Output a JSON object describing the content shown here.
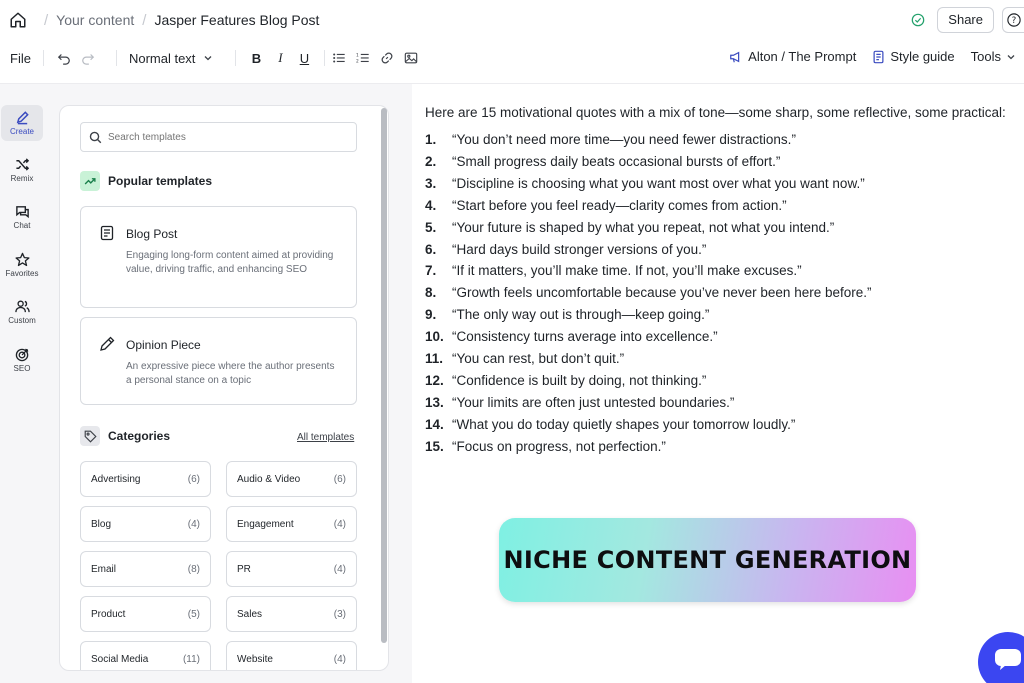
{
  "breadcrumb": {
    "parent": "Your content",
    "current": "Jasper Features Blog Post"
  },
  "header": {
    "share_label": "Share"
  },
  "toolbar": {
    "file_label": "File",
    "text_style": "Normal text",
    "workspace": "Alton / The Prompt",
    "style_guide": "Style guide",
    "tools": "Tools"
  },
  "rail": [
    {
      "label": "Create",
      "icon": "pen-icon",
      "active": true
    },
    {
      "label": "Remix",
      "icon": "shuffle-icon"
    },
    {
      "label": "Chat",
      "icon": "chat-icon"
    },
    {
      "label": "Favorites",
      "icon": "star-icon"
    },
    {
      "label": "Custom",
      "icon": "users-icon"
    },
    {
      "label": "SEO",
      "icon": "target-icon"
    }
  ],
  "sidebar": {
    "search_placeholder": "Search templates",
    "popular_heading": "Popular templates",
    "templates": [
      {
        "title": "Blog Post",
        "desc": "Engaging long-form content aimed at providing value, driving traffic, and enhancing SEO"
      },
      {
        "title": "Opinion Piece",
        "desc": "An expressive piece where the author presents a personal stance on a topic"
      }
    ],
    "categories_heading": "Categories",
    "all_templates": "All templates",
    "categories": [
      {
        "name": "Advertising",
        "count": "(6)"
      },
      {
        "name": "Audio & Video",
        "count": "(6)"
      },
      {
        "name": "Blog",
        "count": "(4)"
      },
      {
        "name": "Engagement",
        "count": "(4)"
      },
      {
        "name": "Email",
        "count": "(8)"
      },
      {
        "name": "PR",
        "count": "(4)"
      },
      {
        "name": "Product",
        "count": "(5)"
      },
      {
        "name": "Sales",
        "count": "(3)"
      },
      {
        "name": "Social Media",
        "count": "(11)"
      },
      {
        "name": "Website",
        "count": "(4)"
      }
    ]
  },
  "document": {
    "intro": "Here are 15 motivational quotes with a mix of tone—some sharp, some reflective, some practical:",
    "quotes": [
      "“You don’t need more time—you need fewer distractions.”",
      "“Small progress daily beats occasional bursts of effort.”",
      "“Discipline is choosing what you want most over what you want now.”",
      "“Start before you feel ready—clarity comes from action.”",
      "“Your future is shaped by what you repeat, not what you intend.”",
      "“Hard days build stronger versions of you.”",
      "“If it matters, you’ll make time. If not, you’ll make excuses.”",
      "“Growth feels uncomfortable because you’ve never been here before.”",
      "“The only way out is through—keep going.”",
      "“Consistency turns average into excellence.”",
      "“You can rest, but don’t quit.”",
      "“Confidence is built by doing, not thinking.”",
      "“Your limits are often just untested boundaries.”",
      "“What you do today quietly shapes your tomorrow loudly.”",
      "“Focus on progress, not perfection.”"
    ]
  },
  "banner": {
    "text": "NICHE CONTENT GENERATION"
  },
  "colors": {
    "accent": "#3b46f1",
    "brand_purple": "#3b4cc0",
    "success": "#22a06b"
  }
}
